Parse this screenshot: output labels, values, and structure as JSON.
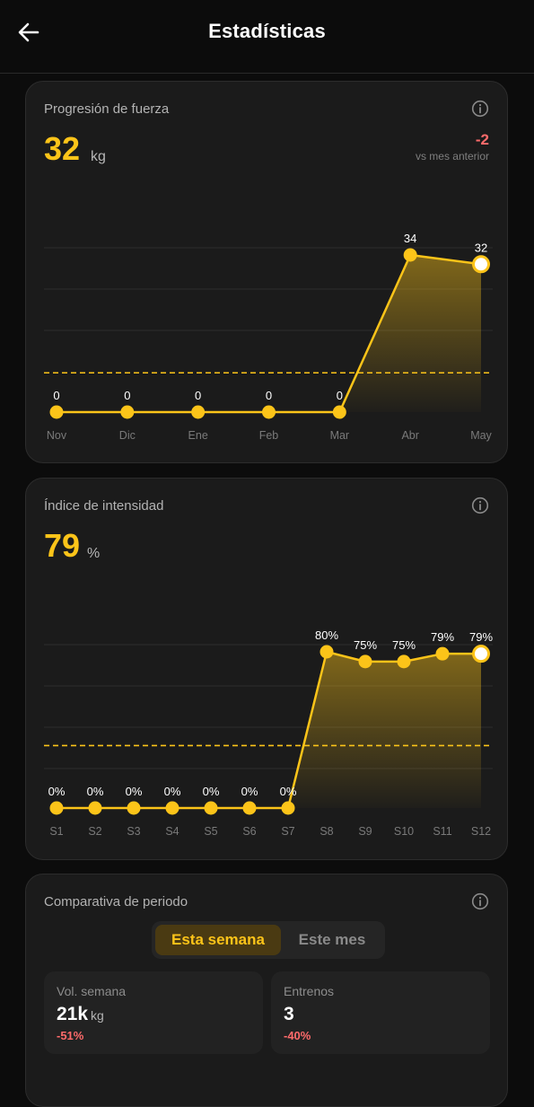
{
  "header": {
    "title": "Estadísticas",
    "back_icon": "arrow-left-icon"
  },
  "colors": {
    "accent": "#fcc419",
    "negative": "#ff6b6b",
    "card": "#1b1b1b",
    "background": "#0c0c0c"
  },
  "strength": {
    "title": "Progresión de fuerza",
    "value": "32",
    "unit": "kg",
    "delta": "-2",
    "delta_caption": "vs mes anterior",
    "info_icon": "info-icon"
  },
  "intensity": {
    "title": "Índice de intensidad",
    "value": "79",
    "unit": "%",
    "info_icon": "info-icon"
  },
  "comparison": {
    "title": "Comparativa de periodo",
    "info_icon": "info-icon",
    "tabs": [
      {
        "label": "Esta semana",
        "active": true
      },
      {
        "label": "Este mes",
        "active": false
      }
    ],
    "stats": [
      {
        "label": "Vol. semana",
        "value": "21k",
        "unit": "kg",
        "delta": "-51%"
      },
      {
        "label": "Entrenos",
        "value": "3",
        "unit": "",
        "delta": "-40%"
      }
    ]
  },
  "chart_data": [
    {
      "type": "line",
      "categories": [
        "Nov",
        "Dic",
        "Ene",
        "Feb",
        "Mar",
        "Abr",
        "May"
      ],
      "values": [
        0,
        0,
        0,
        0,
        0,
        34,
        32
      ],
      "labels": [
        "0",
        "0",
        "0",
        "0",
        "0",
        "34",
        "32"
      ],
      "reference_line": 8.5,
      "ylim": [
        0,
        34
      ],
      "grid": true,
      "area_fill": true
    },
    {
      "type": "line",
      "categories": [
        "S1",
        "S2",
        "S3",
        "S4",
        "S5",
        "S6",
        "S7",
        "S8",
        "S9",
        "S10",
        "S11",
        "S12"
      ],
      "values": [
        0,
        0,
        0,
        0,
        0,
        0,
        0,
        80,
        75,
        75,
        79,
        79
      ],
      "labels": [
        "0%",
        "0%",
        "0%",
        "0%",
        "0%",
        "0%",
        "0%",
        "80%",
        "75%",
        "75%",
        "79%",
        "79%"
      ],
      "reference_line": 32,
      "ylim": [
        0,
        80
      ],
      "grid": true,
      "area_fill": true
    }
  ]
}
